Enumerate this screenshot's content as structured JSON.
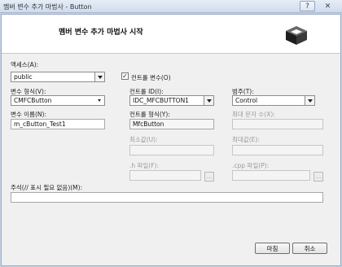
{
  "window": {
    "title": "멤버 변수 추가 마법사 - Button",
    "help_glyph": "?",
    "close_glyph": "✕"
  },
  "header": {
    "title": "멤버 변수 추가 마법사 시작",
    "icon": "box-3d-icon"
  },
  "form": {
    "access": {
      "label": "액세스(A):",
      "value": "public"
    },
    "control_variable": {
      "label": "컨트롤 변수(O)",
      "checked": true,
      "check_glyph": "✓"
    },
    "variable_type": {
      "label": "변수 형식(V):",
      "value": "CMFCButton"
    },
    "variable_name": {
      "label": "변수 이름(N):",
      "value": "m_cButton_Test1"
    },
    "control_id": {
      "label": "컨트롤 ID(I):",
      "value": "IDC_MFCBUTTON1"
    },
    "control_type": {
      "label": "컨트롤 형식(Y):",
      "value": "MfcButton"
    },
    "min_value": {
      "label": "최소값(U):",
      "value": ""
    },
    "h_file": {
      "label": ".h 파일(F):",
      "value": "",
      "browse": "..."
    },
    "category": {
      "label": "범주(T):",
      "value": "Control"
    },
    "max_chars": {
      "label": "최대 문자 수(X):",
      "value": ""
    },
    "max_value": {
      "label": "최대값(E):",
      "value": ""
    },
    "cpp_file": {
      "label": ".cpp 파일(P):",
      "value": "",
      "browse": "..."
    },
    "comment": {
      "label": "주석(// 표시 필요 없음)(M):",
      "value": ""
    }
  },
  "buttons": {
    "finish": "마침",
    "cancel": "취소"
  }
}
